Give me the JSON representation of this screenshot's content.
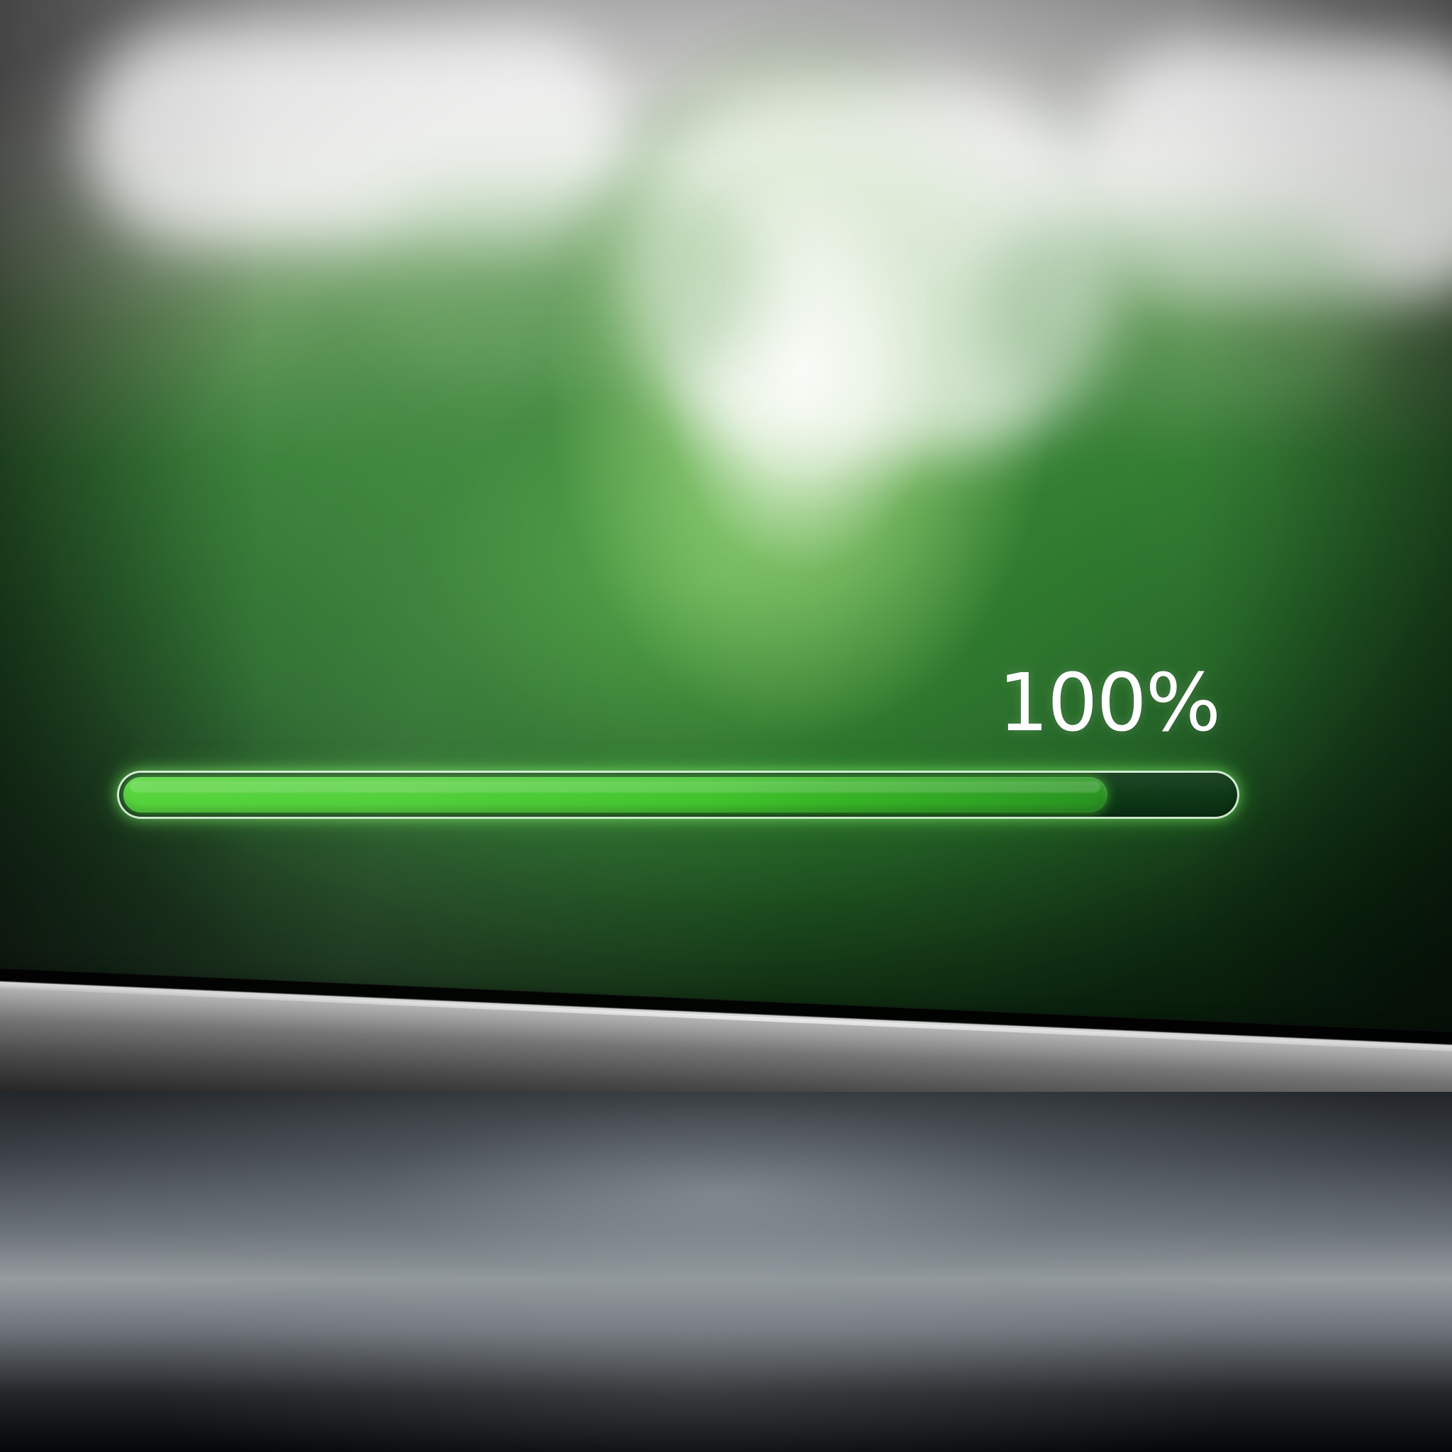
{
  "progress": {
    "label": "100%",
    "fill_fraction": 0.88,
    "colors": {
      "fill": "#4ccf34",
      "track": "#0c3416",
      "outline": "#e6ffe6",
      "glow": "#92ff78",
      "text": "#ffffff"
    }
  },
  "scene": {
    "colors": {
      "screen_green": "#2b6f2f",
      "highlight": "#ffffff",
      "bezel_silver": "#c0c0c0",
      "surface_gray": "#8c9298"
    }
  }
}
